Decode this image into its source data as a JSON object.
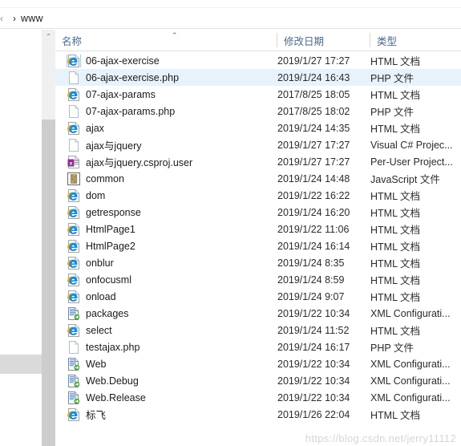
{
  "window": {
    "watermark": "https://blog.csdn.net/jerry11112"
  },
  "addressbar": {
    "back_glyph": "‹",
    "chevron": "›",
    "path_label": "www"
  },
  "columns": {
    "name": "名称",
    "date": "修改日期",
    "type": "类型",
    "sort_caret": "⌃"
  },
  "files": [
    {
      "name": "06-ajax-exercise",
      "date": "2019/1/27 17:27",
      "type": "HTML 文档",
      "icon": "ie-html-icon",
      "selected": false,
      "focused": true
    },
    {
      "name": "06-ajax-exercise.php",
      "date": "2019/1/24 16:43",
      "type": "PHP 文件",
      "icon": "blank-file-icon",
      "selected": true,
      "focused": false
    },
    {
      "name": "07-ajax-params",
      "date": "2017/8/25 18:05",
      "type": "HTML 文档",
      "icon": "ie-html-icon",
      "selected": false,
      "focused": false
    },
    {
      "name": "07-ajax-params.php",
      "date": "2017/8/25 18:02",
      "type": "PHP 文件",
      "icon": "blank-file-icon",
      "selected": false,
      "focused": false
    },
    {
      "name": "ajax",
      "date": "2019/1/24 14:35",
      "type": "HTML 文档",
      "icon": "ie-html-icon",
      "selected": false,
      "focused": false
    },
    {
      "name": "ajax与jquery",
      "date": "2019/1/27 17:27",
      "type": "Visual C# Projec...",
      "icon": "blank-file-icon",
      "selected": false,
      "focused": false
    },
    {
      "name": "ajax与jquery.csproj.user",
      "date": "2019/1/27 17:27",
      "type": "Per-User Project...",
      "icon": "user-project-icon",
      "selected": false,
      "focused": false
    },
    {
      "name": "common",
      "date": "2019/1/24 14:48",
      "type": "JavaScript 文件",
      "icon": "javascript-icon",
      "selected": false,
      "focused": false
    },
    {
      "name": "dom",
      "date": "2019/1/22 16:22",
      "type": "HTML 文档",
      "icon": "ie-html-icon",
      "selected": false,
      "focused": false
    },
    {
      "name": "getresponse",
      "date": "2019/1/24 16:20",
      "type": "HTML 文档",
      "icon": "ie-html-icon",
      "selected": false,
      "focused": false
    },
    {
      "name": "HtmlPage1",
      "date": "2019/1/22 11:06",
      "type": "HTML 文档",
      "icon": "ie-html-icon",
      "selected": false,
      "focused": false
    },
    {
      "name": "HtmlPage2",
      "date": "2019/1/24 16:14",
      "type": "HTML 文档",
      "icon": "ie-html-icon",
      "selected": false,
      "focused": false
    },
    {
      "name": "onblur",
      "date": "2019/1/24 8:35",
      "type": "HTML 文档",
      "icon": "ie-html-icon",
      "selected": false,
      "focused": false
    },
    {
      "name": "onfocusml",
      "date": "2019/1/24 8:59",
      "type": "HTML 文档",
      "icon": "ie-html-icon",
      "selected": false,
      "focused": false
    },
    {
      "name": "onload",
      "date": "2019/1/24 9:07",
      "type": "HTML 文档",
      "icon": "ie-html-icon",
      "selected": false,
      "focused": false
    },
    {
      "name": "packages",
      "date": "2019/1/22 10:34",
      "type": "XML Configurati...",
      "icon": "xml-config-icon",
      "selected": false,
      "focused": false
    },
    {
      "name": "select",
      "date": "2019/1/24 11:52",
      "type": "HTML 文档",
      "icon": "ie-html-icon",
      "selected": false,
      "focused": false
    },
    {
      "name": "testajax.php",
      "date": "2019/1/24 16:17",
      "type": "PHP 文件",
      "icon": "blank-file-icon",
      "selected": false,
      "focused": false
    },
    {
      "name": "Web",
      "date": "2019/1/22 10:34",
      "type": "XML Configurati...",
      "icon": "xml-config-icon",
      "selected": false,
      "focused": false
    },
    {
      "name": "Web.Debug",
      "date": "2019/1/22 10:34",
      "type": "XML Configurati...",
      "icon": "xml-config-icon",
      "selected": false,
      "focused": false
    },
    {
      "name": "Web.Release",
      "date": "2019/1/22 10:34",
      "type": "XML Configurati...",
      "icon": "xml-config-icon",
      "selected": false,
      "focused": false
    },
    {
      "name": "标飞",
      "date": "2019/1/26 22:04",
      "type": "HTML 文档",
      "icon": "ie-html-icon",
      "selected": false,
      "focused": false
    }
  ],
  "scrollbar": {
    "up_arrow": "⌃"
  },
  "colors": {
    "selection": "#e8f2fb",
    "header_text": "#4a6a8a",
    "scrollbar_thumb": "#cdcdcd",
    "watermark": "#d6d6d6"
  }
}
